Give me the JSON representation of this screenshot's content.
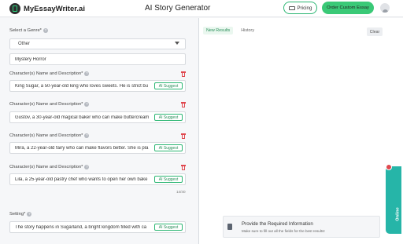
{
  "header": {
    "logo_text": "MyEssayWriter.ai",
    "title": "AI Story Generator",
    "pricing_label": "Pricing",
    "order_label": "Order Custom Essay"
  },
  "form": {
    "genre_label": "Select a Genre*",
    "genre_value": "Other",
    "custom_genre_value": "Mystery Horror",
    "character_label": "Character(s) Name and Description*",
    "characters": [
      "King Sugar, a 50-year-old king who loves sweets. He is strict bu",
      "Gustov, a 30-year-old magical baker who can make buttercream",
      "Mira, a 22-year-old fairy who can make flavors better. She is pla",
      "Lila, a 25-year-old pastry chef who wants to open her own bake"
    ],
    "ai_suggest_label": "AI Suggest",
    "character_counter": "14/40",
    "setting_label": "Setting*",
    "setting_value": "The story happens in Sugarland, a bright kingdom filled with ca"
  },
  "results": {
    "tab_new": "New Results",
    "tab_history": "History",
    "clear_label": "Clear",
    "info_title": "Provide the Required Information",
    "info_sub": "Make sure to fill out all the fields for the best results!"
  },
  "chat": {
    "online_label": "Online"
  },
  "colors": {
    "accent": "#2bb673",
    "order_button": "#3ac977",
    "delete": "#e0484f",
    "online_tab": "#26b5a8"
  },
  "icons": {
    "logo": "logo-icon",
    "pricing": "cart-icon",
    "avatar": "user-icon",
    "help": "help-icon",
    "dropdown": "chevron-down-icon",
    "delete": "trash-icon",
    "info": "document-icon"
  }
}
